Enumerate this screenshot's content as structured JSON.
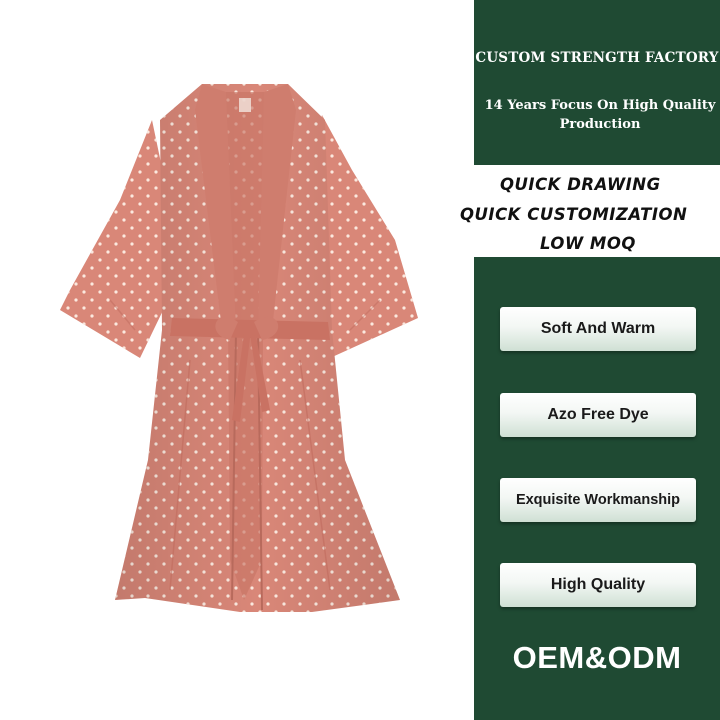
{
  "header": {
    "title": "CUSTOM STRENGTH FACTORY",
    "subtitle": "14 Years Focus On High Quality Production"
  },
  "features_band": {
    "lines": [
      "QUICK DRAWING",
      "QUICK CUSTOMIZATION",
      "LOW MOQ"
    ]
  },
  "buttons": [
    {
      "label": "Soft And Warm"
    },
    {
      "label": "Azo Free Dye"
    },
    {
      "label": "Exquisite Workmanship"
    },
    {
      "label": "High Quality"
    }
  ],
  "footer": {
    "label": "OEM&ODM"
  },
  "colors": {
    "panel_green": "#1f4a33",
    "robe_pink": "#d98778",
    "dot_color": "#fbe9df"
  },
  "image": {
    "subject": "product-photo-pink-polka-dot-robe"
  }
}
